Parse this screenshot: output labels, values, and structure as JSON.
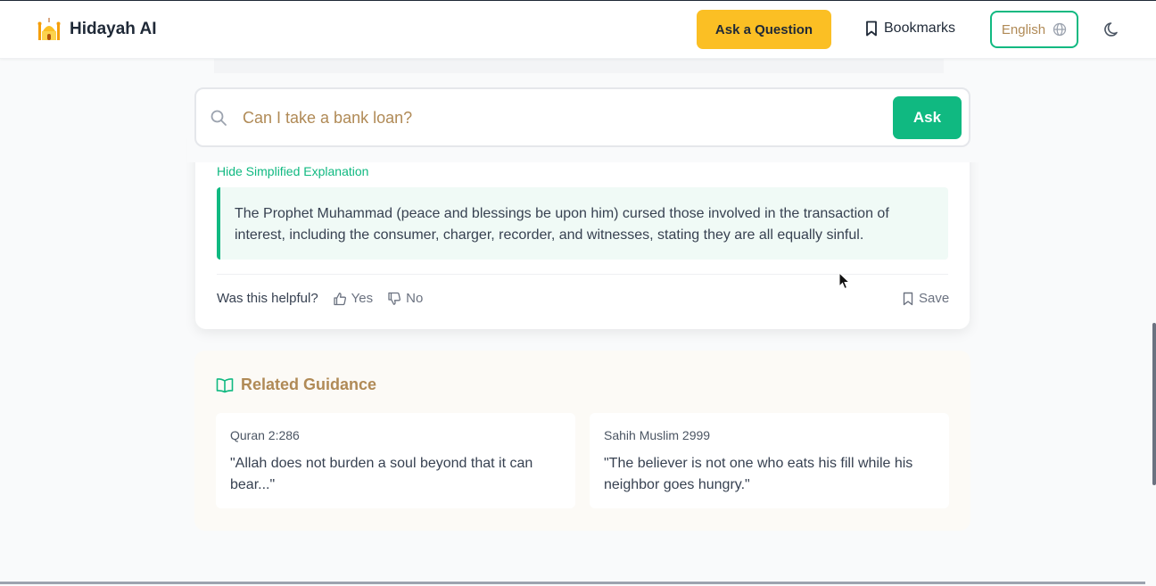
{
  "header": {
    "brand_name": "Hidayah AI",
    "ask_question_label": "Ask a Question",
    "bookmarks_label": "Bookmarks",
    "language_label": "English"
  },
  "search": {
    "placeholder": "Can I take a bank loan?",
    "ask_label": "Ask"
  },
  "answer": {
    "hide_simplified_label": "Hide Simplified Explanation",
    "simplified_text": "The Prophet Muhammad (peace and blessings be upon him) cursed those involved in the transaction of interest, including the consumer, charger, recorder, and witnesses, stating they are all equally sinful.",
    "helpful_prompt": "Was this helpful?",
    "yes_label": "Yes",
    "no_label": "No",
    "save_label": "Save"
  },
  "related": {
    "title": "Related Guidance",
    "items": [
      {
        "source": "Quran 2:286",
        "quote": "\"Allah does not burden a soul beyond that it can bear...\""
      },
      {
        "source": "Sahih Muslim 2999",
        "quote": "\"The believer is not one who eats his fill while his neighbor goes hungry.\""
      }
    ]
  },
  "colors": {
    "accent_green": "#10b981",
    "accent_yellow": "#fbbf24",
    "gold_text": "#b08a56"
  }
}
